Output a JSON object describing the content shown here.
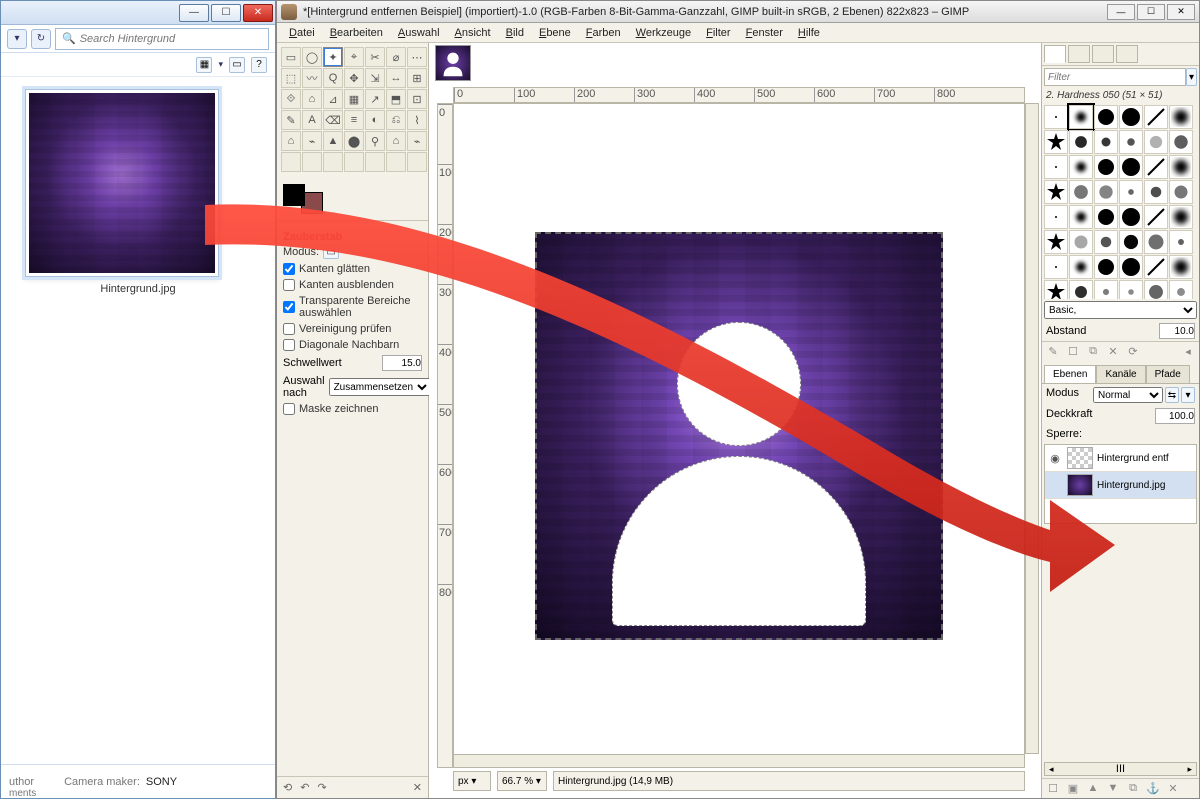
{
  "explorer": {
    "search_placeholder": "Search Hintergrund",
    "thumb_label": "Hintergrund.jpg",
    "meta": {
      "author_label": "uthor",
      "maker_label": "Camera maker:",
      "maker_value": "SONY",
      "comments_label": "ments"
    }
  },
  "gimp": {
    "title": "*[Hintergrund entfernen Beispiel] (importiert)-1.0 (RGB-Farben 8-Bit-Gamma-Ganzzahl, GIMP built-in sRGB, 2 Ebenen) 822x823 – GIMP",
    "menu": [
      "Datei",
      "Bearbeiten",
      "Auswahl",
      "Ansicht",
      "Bild",
      "Ebene",
      "Farben",
      "Werkzeuge",
      "Filter",
      "Fenster",
      "Hilfe"
    ],
    "tool_options": {
      "title": "Zauberstab",
      "modus_label": "Modus:",
      "opts": [
        "Kanten glätten",
        "Kanten ausblenden",
        "Transparente Bereiche auswählen",
        "Vereinigung prüfen",
        "Diagonale Nachbarn"
      ],
      "opt_checked": [
        true,
        false,
        true,
        false,
        false
      ],
      "threshold_label": "Schwellwert",
      "threshold_value": "15.0",
      "select_by_label": "Auswahl nach",
      "select_by_value": "Zusammensetzen",
      "mask_label": "Maske zeichnen"
    },
    "ruler_marks": [
      "0",
      "100",
      "200",
      "300",
      "400",
      "500",
      "600",
      "700",
      "800"
    ],
    "status": {
      "px": "px ▾",
      "zoom": "66.7 % ▾",
      "file": "Hintergrund.jpg (14,9 MB)"
    },
    "right": {
      "filter_placeholder": "Filter",
      "brush_name": "2. Hardness 050 (51 × 51)",
      "basic_label": "Basic,",
      "spacing_label": "Abstand",
      "spacing_value": "10.0",
      "tabs": [
        "Ebenen",
        "Kanäle",
        "Pfade"
      ],
      "mode_label": "Modus",
      "mode_value": "Normal",
      "opacity_label": "Deckkraft",
      "opacity_value": "100.0",
      "lock_label": "Sperre:",
      "layers": [
        {
          "name": "Hintergrund entf",
          "checker": true
        },
        {
          "name": "Hintergrund.jpg",
          "checker": false
        }
      ],
      "scroll_label": "III"
    }
  }
}
